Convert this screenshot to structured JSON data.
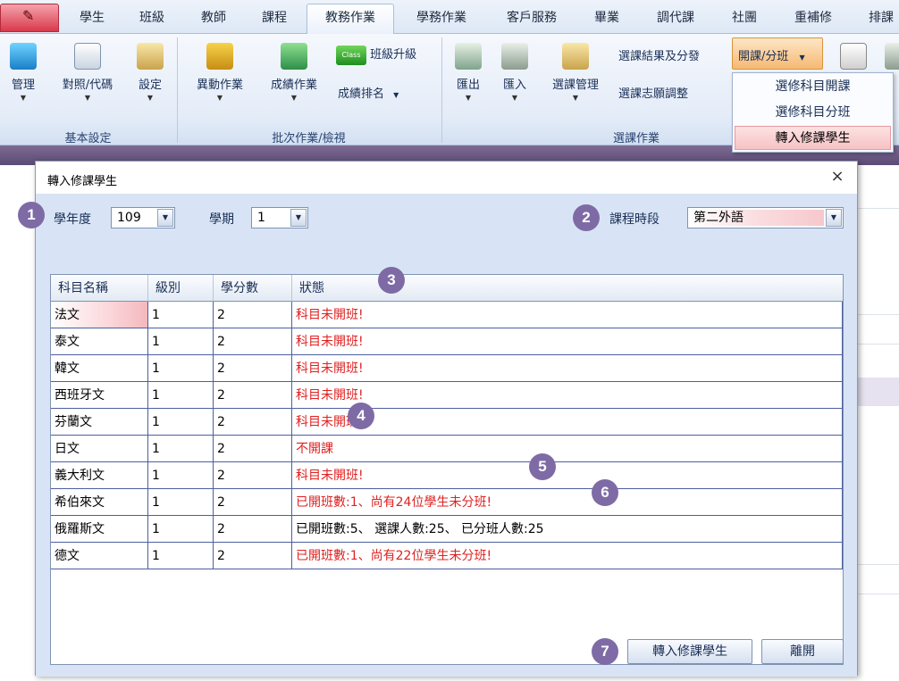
{
  "tabs": [
    {
      "label": "學生"
    },
    {
      "label": "班級"
    },
    {
      "label": "教師"
    },
    {
      "label": "課程"
    },
    {
      "label": "教務作業"
    },
    {
      "label": "學務作業"
    },
    {
      "label": "客戶服務"
    },
    {
      "label": "畢業"
    },
    {
      "label": "調代課"
    },
    {
      "label": "社團"
    },
    {
      "label": "重補修"
    },
    {
      "label": "排課"
    }
  ],
  "ribbon": {
    "basic": {
      "manage": "管理",
      "mapping": "對照/代碼",
      "settings": "設定",
      "group_label": "基本設定"
    },
    "batch": {
      "change": "異動作業",
      "grades": "成績作業",
      "class_promote": "班級升級",
      "class_icon_text": "Class",
      "rank": "成績排名",
      "group_label": "批次作業/檢視"
    },
    "course": {
      "export": "匯出",
      "import": "匯入",
      "course_mgmt": "選課管理",
      "result_assign": "選課結果及分發",
      "wish_adjust": "選課志願調整",
      "group_label": "選課作業"
    },
    "open_class": "開課/分班"
  },
  "dropdown": {
    "items": [
      "選修科目開課",
      "選修科目分班",
      "轉入修課學生"
    ]
  },
  "dialog": {
    "title": "轉入修課學生",
    "school_year_label": "學年度",
    "school_year_value": "109",
    "semester_label": "學期",
    "semester_value": "1",
    "period_label": "課程時段",
    "period_value": "第二外語",
    "columns": [
      "科目名稱",
      "級別",
      "學分數",
      "狀態"
    ],
    "rows": [
      {
        "name": "法文",
        "level": "1",
        "credits": "2",
        "status": "科目未開班!",
        "status_color": "#e02020"
      },
      {
        "name": "泰文",
        "level": "1",
        "credits": "2",
        "status": "科目未開班!",
        "status_color": "#e02020"
      },
      {
        "name": "韓文",
        "level": "1",
        "credits": "2",
        "status": "科目未開班!",
        "status_color": "#e02020"
      },
      {
        "name": "西班牙文",
        "level": "1",
        "credits": "2",
        "status": "科目未開班!",
        "status_color": "#e02020"
      },
      {
        "name": "芬蘭文",
        "level": "1",
        "credits": "2",
        "status": "科目未開班!",
        "status_color": "#e02020"
      },
      {
        "name": "日文",
        "level": "1",
        "credits": "2",
        "status": "不開課",
        "status_color": "#e02020"
      },
      {
        "name": "義大利文",
        "level": "1",
        "credits": "2",
        "status": "科目未開班!",
        "status_color": "#e02020"
      },
      {
        "name": "希伯來文",
        "level": "1",
        "credits": "2",
        "status": "已開班數:1、尚有24位學生未分班!",
        "status_color": "#e02020"
      },
      {
        "name": "俄羅斯文",
        "level": "1",
        "credits": "2",
        "status": "已開班數:5、 選課人數:25、 已分班人數:25",
        "status_color": "#000000"
      },
      {
        "name": "德文",
        "level": "1",
        "credits": "2",
        "status": "已開班數:1、尚有22位學生未分班!",
        "status_color": "#e02020"
      }
    ],
    "transfer_button": "轉入修課學生",
    "leave_button": "離開",
    "close_symbol": "×"
  },
  "callouts": [
    "1",
    "2",
    "3",
    "4",
    "5",
    "6",
    "7"
  ],
  "colors": {
    "accent_purple": "#7e6ba5",
    "error_red": "#e02020",
    "ribbon_blue": "#dde7f5"
  }
}
